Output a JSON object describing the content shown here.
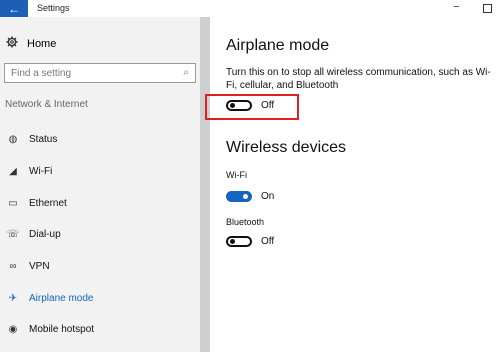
{
  "window": {
    "title": "Settings",
    "back_glyph": "←",
    "min_glyph": "−"
  },
  "sidebar": {
    "home_label": "Home",
    "home_icon": "gear-icon",
    "search_placeholder": "Find a setting",
    "search_icon_glyph": "⌕",
    "section_label": "Network & Internet",
    "items": [
      {
        "label": "Status",
        "icon": "globe-icon",
        "glyph": "◍"
      },
      {
        "label": "Wi-Fi",
        "icon": "wifi-icon",
        "glyph": "◢"
      },
      {
        "label": "Ethernet",
        "icon": "ethernet-icon",
        "glyph": "▭"
      },
      {
        "label": "Dial-up",
        "icon": "dialup-icon",
        "glyph": "☏"
      },
      {
        "label": "VPN",
        "icon": "vpn-icon",
        "glyph": "∞"
      },
      {
        "label": "Airplane mode",
        "icon": "airplane-icon",
        "glyph": "✈"
      },
      {
        "label": "Mobile hotspot",
        "icon": "hotspot-icon",
        "glyph": "◉"
      }
    ],
    "active_item": "Airplane mode"
  },
  "main": {
    "airplane": {
      "heading": "Airplane mode",
      "description": "Turn this on to stop all wireless communication, such as Wi-Fi, cellular, and Bluetooth",
      "toggle_state": "Off"
    },
    "wireless": {
      "heading": "Wireless devices",
      "wifi": {
        "label": "Wi-Fi",
        "state": "On"
      },
      "bluetooth": {
        "label": "Bluetooth",
        "state": "Off"
      }
    }
  },
  "colors": {
    "accent": "#1565c0",
    "back_button": "#1b5fb7",
    "highlight": "#e02020",
    "sidebar_bg": "#f2f2f2"
  }
}
